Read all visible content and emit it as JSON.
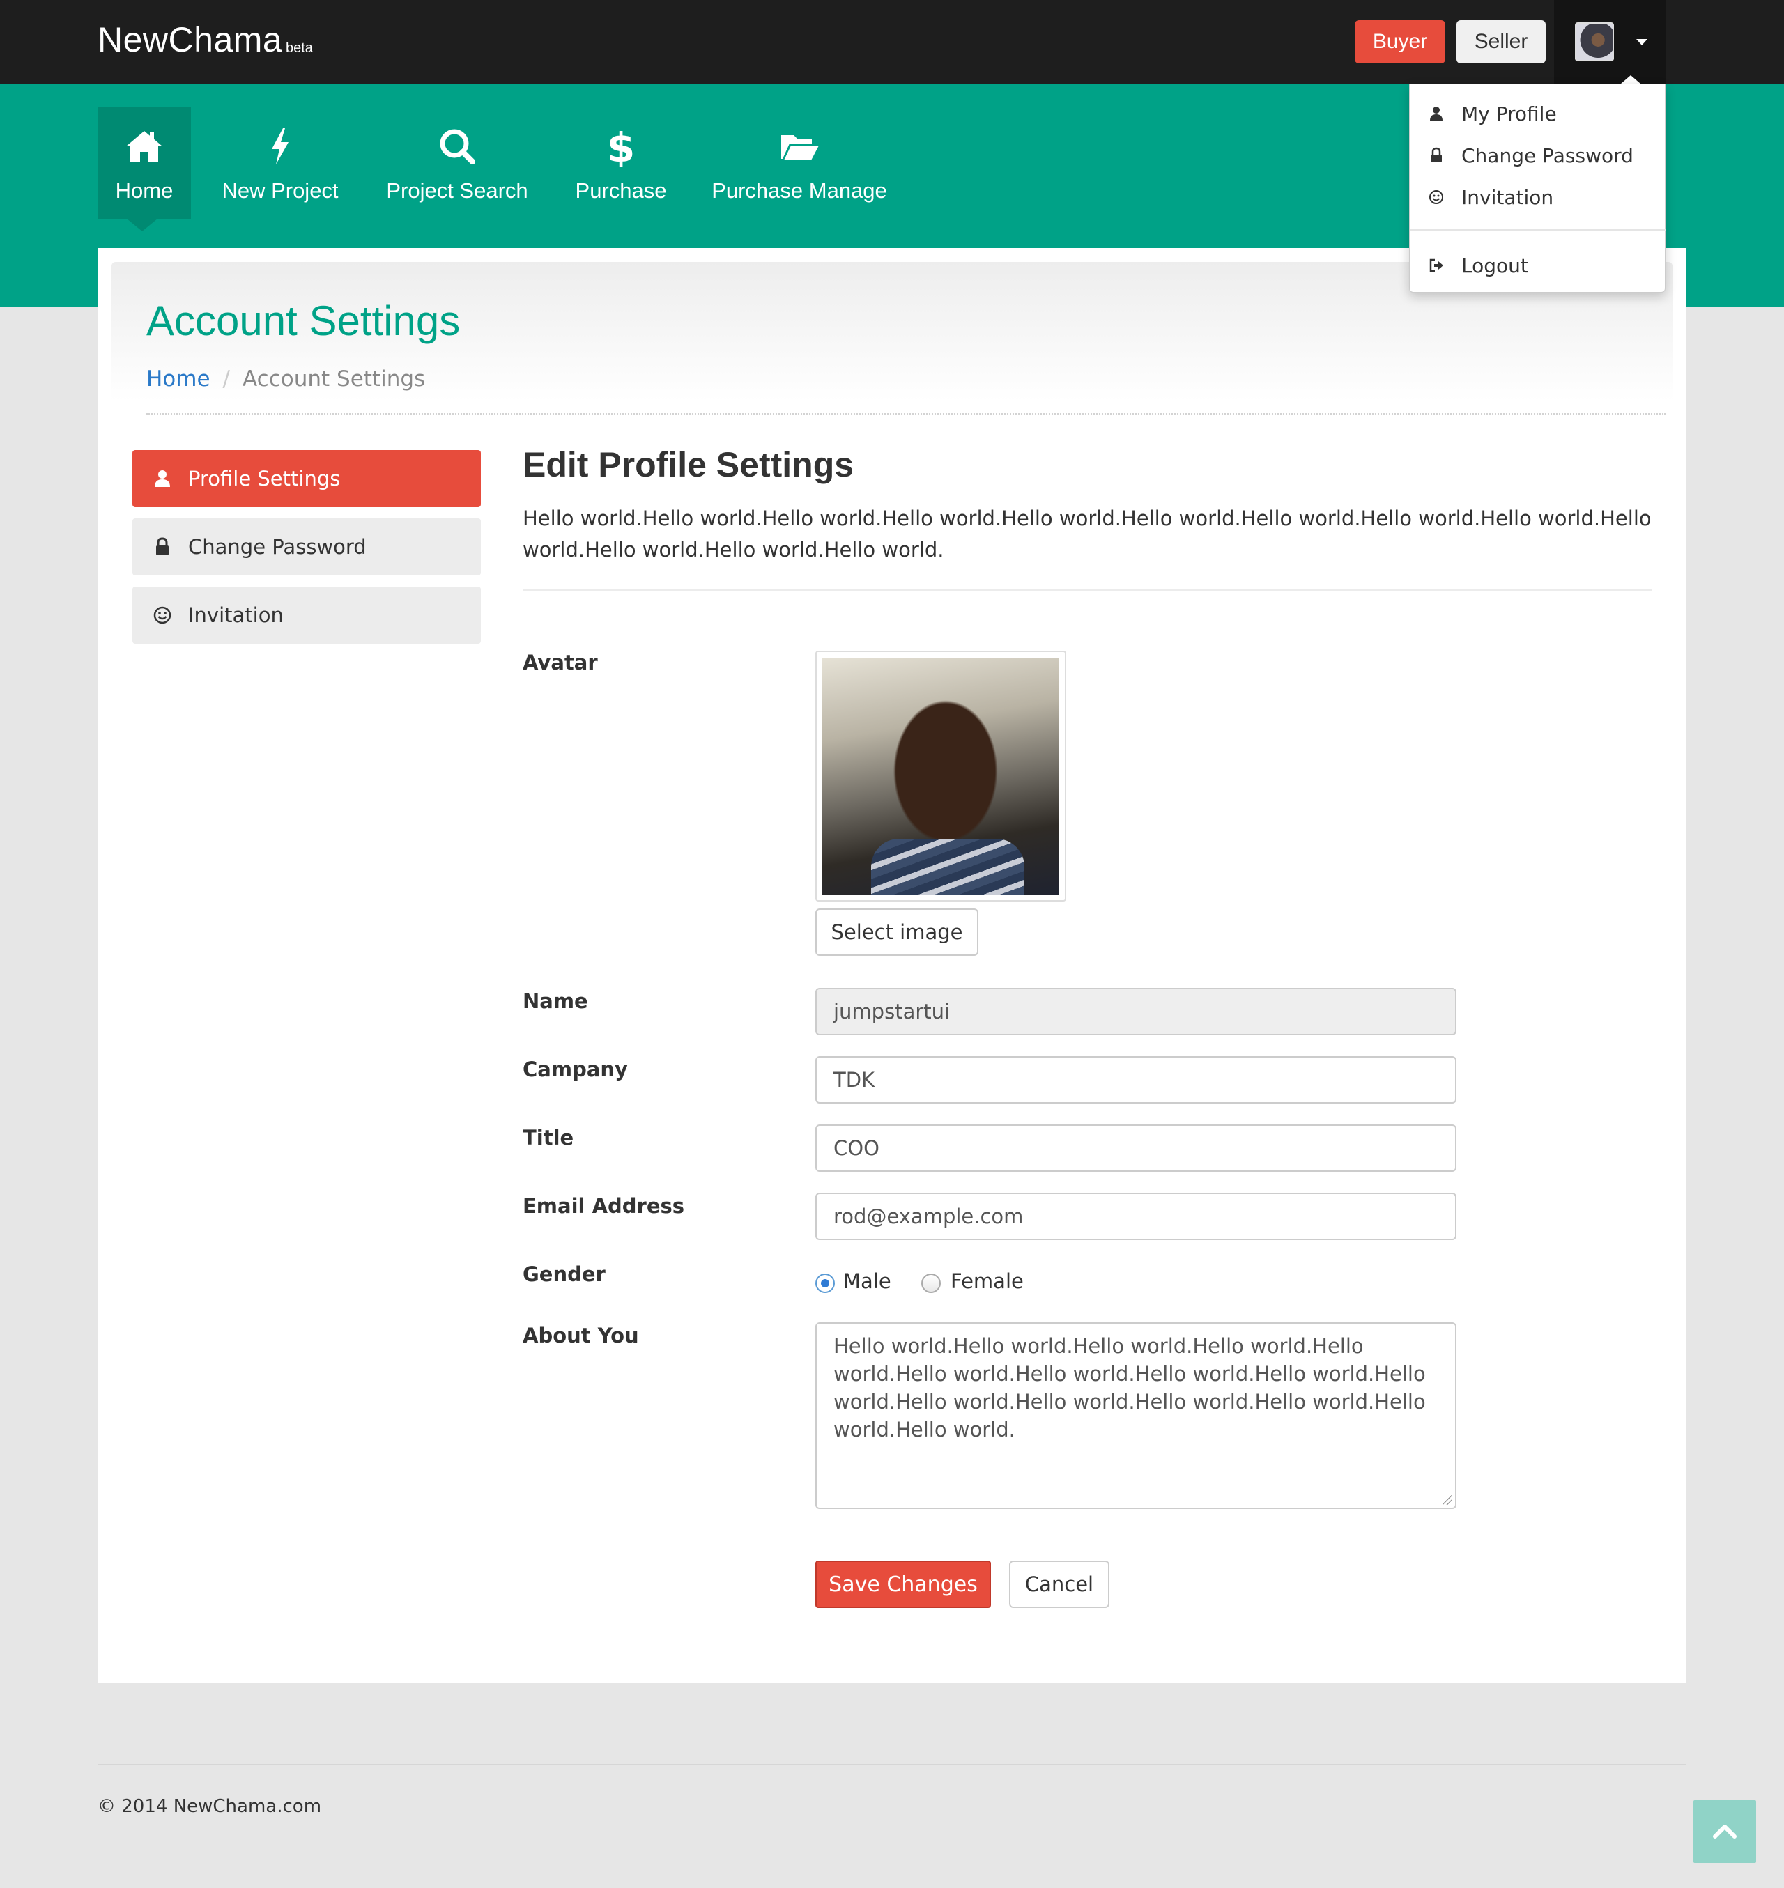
{
  "topbar": {
    "brand": "NewChama",
    "beta": "beta",
    "buyer_label": "Buyer",
    "seller_label": "Seller"
  },
  "nav": [
    {
      "label": "Home",
      "icon": "home-icon",
      "active": true
    },
    {
      "label": "New Project",
      "icon": "bolt-icon"
    },
    {
      "label": "Project Search",
      "icon": "search-icon"
    },
    {
      "label": "Purchase",
      "icon": "dollar-icon"
    },
    {
      "label": "Purchase Manage",
      "icon": "folder-open-icon"
    }
  ],
  "dropdown": {
    "items": [
      {
        "label": "My Profile",
        "icon": "user-icon"
      },
      {
        "label": "Change Password",
        "icon": "lock-icon"
      },
      {
        "label": "Invitation",
        "icon": "smile-icon"
      },
      {
        "label": "Logout",
        "icon": "sign-out-icon"
      }
    ]
  },
  "page": {
    "title": "Account Settings",
    "breadcrumb": {
      "home": "Home",
      "current": "Account Settings"
    }
  },
  "sidebar": {
    "items": [
      {
        "label": "Profile Settings",
        "icon": "user-icon",
        "active": true
      },
      {
        "label": "Change Password",
        "icon": "lock-icon"
      },
      {
        "label": "Invitation",
        "icon": "smile-icon"
      }
    ]
  },
  "content": {
    "title": "Edit Profile Settings",
    "description": "Hello world.Hello world.Hello world.Hello world.Hello world.Hello world.Hello world.Hello world.Hello world.Hello world.Hello world.Hello world.Hello world."
  },
  "form": {
    "avatar_label": "Avatar",
    "select_image_label": "Select image",
    "name_label": "Name",
    "name_value": "jumpstartui",
    "company_label": "Campany",
    "company_value": "TDK",
    "title_label": "Title",
    "title_value": "COO",
    "email_label": "Email Address",
    "email_value": "rod@example.com",
    "gender_label": "Gender",
    "gender_options": [
      "Male",
      "Female"
    ],
    "gender_selected": "Male",
    "about_label": "About You",
    "about_value": "Hello world.Hello world.Hello world.Hello world.Hello world.Hello world.Hello world.Hello world.Hello world.Hello world.Hello world.Hello world.Hello world.Hello world.Hello world.Hello world.",
    "save_label": "Save Changes",
    "cancel_label": "Cancel"
  },
  "footer": {
    "copyright": "© 2014 NewChama.com"
  },
  "colors": {
    "topbar": "#1e1e1e",
    "brand_green": "#00a287",
    "accent_red": "#e74c3c",
    "link_blue": "#2a79c8"
  }
}
